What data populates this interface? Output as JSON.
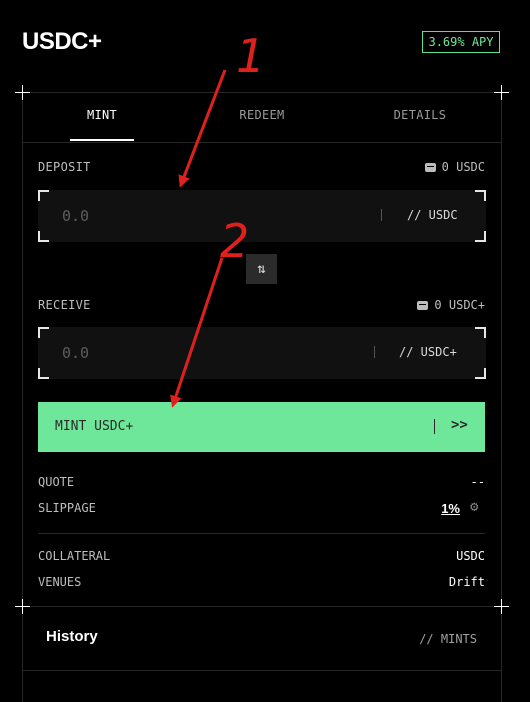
{
  "header": {
    "title": "USDC+",
    "apy_badge": "3.69% APY"
  },
  "tabs": [
    {
      "label": "MINT",
      "active": true
    },
    {
      "label": "REDEEM",
      "active": false
    },
    {
      "label": "DETAILS",
      "active": false
    }
  ],
  "deposit": {
    "label": "DEPOSIT",
    "balance": "0 USDC",
    "placeholder": "0.0",
    "unit": "// USDC"
  },
  "receive": {
    "label": "RECEIVE",
    "balance": "0 USDC+",
    "placeholder": "0.0",
    "unit": "// USDC+"
  },
  "mint_button": {
    "label": "MINT USDC+",
    "chevron": ">>"
  },
  "quote": {
    "label": "QUOTE",
    "value": "--"
  },
  "slippage": {
    "label": "SLIPPAGE",
    "value": "1%"
  },
  "collateral": {
    "label": "COLLATERAL",
    "value": "USDC"
  },
  "venues": {
    "label": "VENUES",
    "value": "Drift"
  },
  "history": {
    "title": "History",
    "filter": "// MINTS"
  },
  "annotations": {
    "mark_1": "1",
    "mark_2": "2"
  },
  "colors": {
    "accent": "#6ee79a",
    "background": "#000000",
    "annotation": "#e0201c"
  }
}
